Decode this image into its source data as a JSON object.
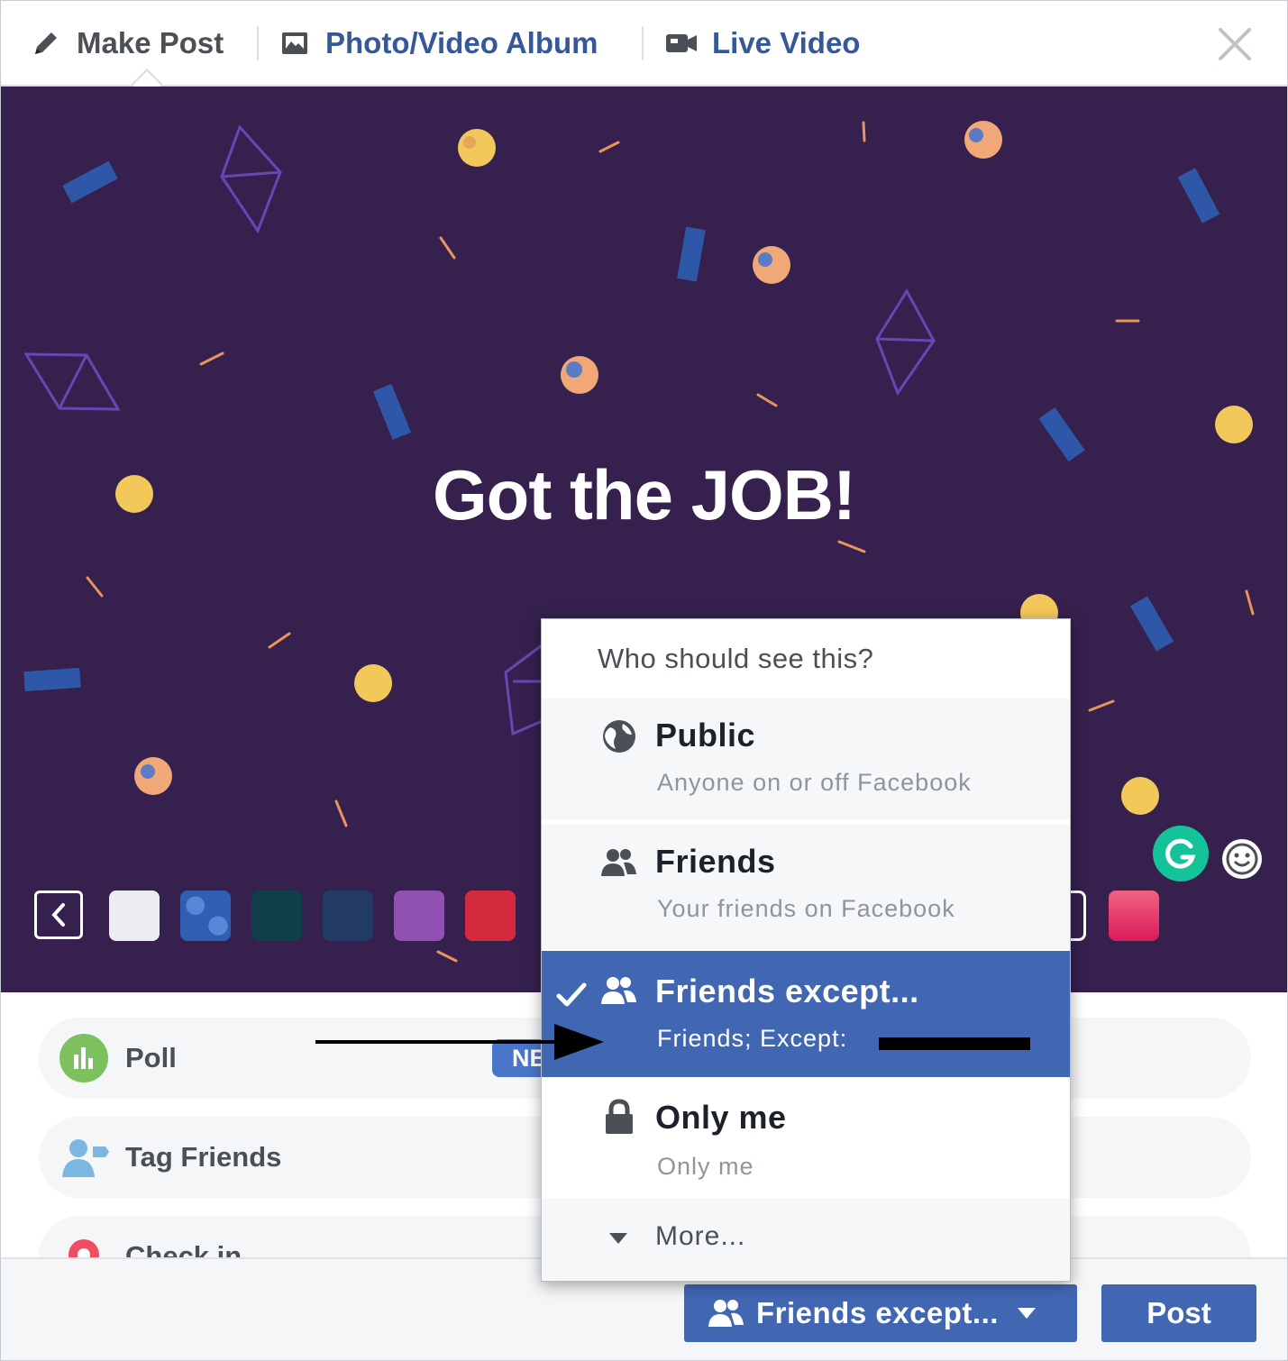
{
  "header": {
    "tabs": [
      {
        "label": "Make Post",
        "icon": "pencil-icon"
      },
      {
        "label": "Photo/Video Album",
        "icon": "photo-album-icon"
      },
      {
        "label": "Live Video",
        "icon": "video-camera-icon"
      }
    ],
    "close_icon": "close-icon"
  },
  "composer": {
    "text": "Got the JOB!",
    "background_color": "#35204e",
    "swatches": [
      "#eceef4",
      "#2f5fb3",
      "#0f3f49",
      "#223a66",
      "#8f52b3",
      "#d42a3d",
      "#e4436e"
    ]
  },
  "options": [
    {
      "label": "Poll",
      "icon": "poll-icon",
      "badge": "NE"
    },
    {
      "label": "Tag Friends",
      "icon": "tag-friends-icon"
    },
    {
      "label": "Check in",
      "icon": "check-in-icon"
    }
  ],
  "dropdown": {
    "header": "Who should see this?",
    "items": [
      {
        "title": "Public",
        "subtitle": "Anyone on or off Facebook",
        "icon": "globe-icon",
        "selected": false
      },
      {
        "title": "Friends",
        "subtitle": "Your friends on Facebook",
        "icon": "friends-icon",
        "selected": false
      },
      {
        "title": "Friends except...",
        "subtitle": "Friends; Except:",
        "icon": "friends-except-icon",
        "selected": true
      },
      {
        "title": "Only me",
        "subtitle": "Only me",
        "icon": "lock-icon",
        "selected": false
      }
    ],
    "more_label": "More..."
  },
  "footer": {
    "audience_label": "Friends except...",
    "post_label": "Post"
  },
  "colors": {
    "facebook_blue": "#4267b2",
    "link_blue": "#365899",
    "purple_background": "#35204e"
  }
}
